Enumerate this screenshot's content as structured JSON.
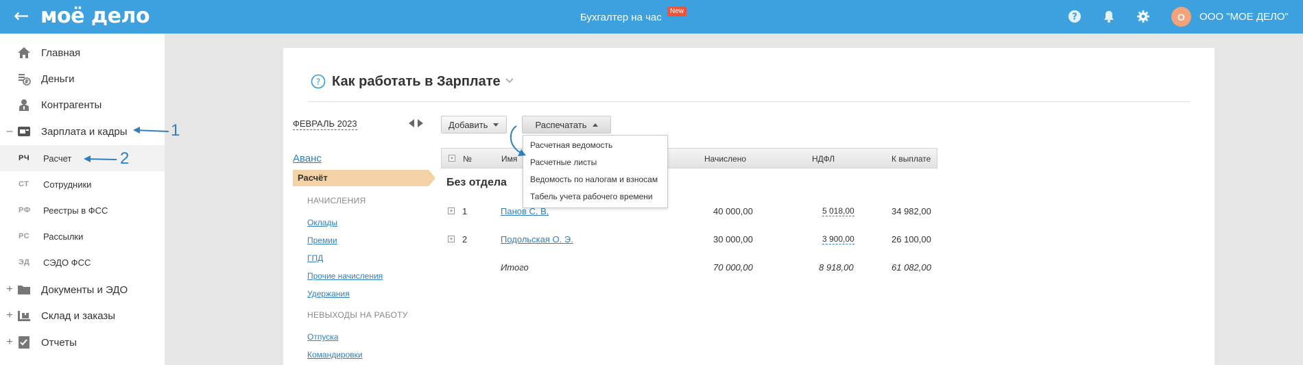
{
  "topbar": {
    "back_icon": "arrow-left-icon",
    "logo": "моё дело",
    "center_link": "Бухгалтер на час",
    "new_badge": "New",
    "avatar_letter": "О",
    "company": "ООО \"МОЕ ДЕЛО\"",
    "accent_color": "#3da1e0"
  },
  "sidebar": {
    "items": [
      {
        "label": "Главная",
        "icon": "home-icon",
        "prefix": ""
      },
      {
        "label": "Деньги",
        "icon": "money-icon",
        "prefix": ""
      },
      {
        "label": "Контрагенты",
        "icon": "contractors-icon",
        "prefix": ""
      },
      {
        "label": "Зарплата и кадры",
        "icon": "salary-icon",
        "prefix": "–"
      },
      {
        "label": "Документы и ЭДО",
        "icon": "folder-icon",
        "prefix": "+"
      },
      {
        "label": "Склад и заказы",
        "icon": "warehouse-icon",
        "prefix": "+"
      },
      {
        "label": "Отчеты",
        "icon": "reports-icon",
        "prefix": "+"
      }
    ],
    "subitems": [
      {
        "abbr": "РЧ",
        "label": "Расчет"
      },
      {
        "abbr": "СТ",
        "label": "Сотрудники"
      },
      {
        "abbr": "РФ",
        "label": "Реестры в ФСС"
      },
      {
        "abbr": "РС",
        "label": "Рассылки"
      },
      {
        "abbr": "ЭД",
        "label": "СЭДО ФСС"
      }
    ],
    "annotations": [
      "1",
      "2"
    ]
  },
  "main": {
    "title": "Как работать в Зарплате",
    "month": "ФЕВРАЛЬ 2023",
    "avans": "Аванс",
    "raschet": "Расчёт",
    "sections": [
      {
        "heading": "НАЧИСЛЕНИЯ",
        "links": [
          "Оклады",
          "Премии",
          "ГПД",
          "Прочие начисления",
          "Удержания"
        ]
      },
      {
        "heading": "НЕВЫХОДЫ НА РАБОТУ",
        "links": [
          "Отпуска",
          "Командировки"
        ]
      }
    ],
    "buttons": {
      "add": "Добавить",
      "print": "Распечатать"
    },
    "print_menu": [
      "Расчетная ведомость",
      "Расчетные листы",
      "Ведомость по налогам и взносам",
      "Табель учета рабочего времени"
    ],
    "table": {
      "headers": {
        "num": "№",
        "name": "Имя",
        "accrued": "Начислено",
        "ndfl": "НДФЛ",
        "payout": "К выплате"
      },
      "group": "Без отдела",
      "rows": [
        {
          "num": "1",
          "name": "Панов С. В.",
          "accrued": "40 000,00",
          "ndfl": "5 018,00",
          "payout": "34 982,00"
        },
        {
          "num": "2",
          "name": "Подольская О. Э.",
          "accrued": "30 000,00",
          "ndfl": "3 900,00",
          "payout": "26 100,00"
        }
      ],
      "total": {
        "label": "Итого",
        "accrued": "70 000,00",
        "ndfl": "8 918,00",
        "payout": "61 082,00"
      }
    }
  }
}
